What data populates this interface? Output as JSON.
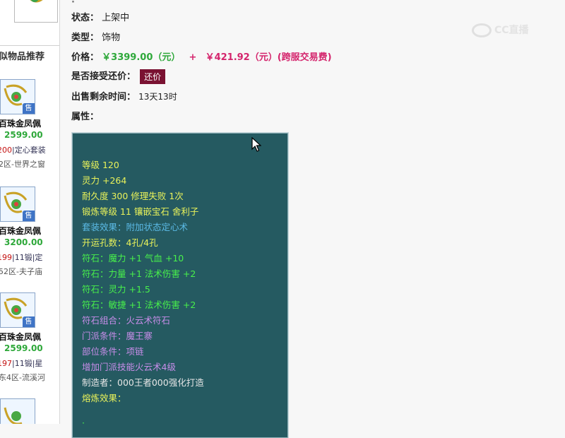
{
  "sidebar": {
    "section_title": "似物品推荐",
    "items": [
      {
        "name": "百珠金凤佩",
        "price": "2599.00",
        "tag_red": "200",
        "tag_rest": "|定心套装",
        "server": "2区-世界之窗",
        "badge": "售"
      },
      {
        "name": "百珠金凤佩",
        "price": "3200.00",
        "tag_red": "199",
        "tag_rest": "|11锻|定",
        "server": "52区-夫子庙",
        "badge": "售"
      },
      {
        "name": "百珠金凤佩",
        "price": "2599.00",
        "tag_red": "197",
        "tag_rest": "|11锻|星",
        "server": "东4区-流溪河",
        "badge": "售"
      }
    ]
  },
  "details": {
    "status_label": "状态：",
    "status_value": "上架中",
    "type_label": "类型：",
    "type_value": "饰物",
    "price_label": "价格：",
    "price_value": "￥3399.00（元）",
    "plus": "+",
    "fee_value": "￥421.92（元）(跨服交易费)",
    "counter_label": "是否接受还价：",
    "counter_button": "还价",
    "remaining_label": "出售剩余时间：",
    "remaining_value": "13天13时",
    "attr_label": "属性："
  },
  "attributes": [
    {
      "text": "等级 120",
      "color": "yellow"
    },
    {
      "text": "灵力 +264",
      "color": "yellow"
    },
    {
      "text": "耐久度 300 修理失败 1次",
      "color": "yellow"
    },
    {
      "text": "锻炼等级 11 镶嵌宝石 舍利子",
      "color": "yellow"
    },
    {
      "text": "套装效果：附加状态定心术",
      "color": "blue"
    },
    {
      "text": "开运孔数：4孔/4孔",
      "color": "yellow"
    },
    {
      "text": "符石：魔力 +1 气血 +10",
      "color": "green"
    },
    {
      "text": "符石：力量 +1 法术伤害 +2",
      "color": "green"
    },
    {
      "text": "符石：灵力 +1.5",
      "color": "green"
    },
    {
      "text": "符石：敏捷 +1 法术伤害 +2",
      "color": "green"
    },
    {
      "text": "符石组合：火云术符石",
      "color": "purple"
    },
    {
      "text": "门派条件：魔王寨",
      "color": "purple"
    },
    {
      "text": "部位条件：项链",
      "color": "purple"
    },
    {
      "text": "增加门派技能火云术4级",
      "color": "purple"
    },
    {
      "text": "制造者：000王者000强化打造",
      "color": "white"
    },
    {
      "text": "熔炼效果：",
      "color": "yellow"
    }
  ],
  "watermark": "CC直播",
  "colors": {
    "panel_bg": "#255a61",
    "price_green": "#2ea83a",
    "fee_pink": "#d4246c",
    "button_bg": "#7a1232"
  }
}
